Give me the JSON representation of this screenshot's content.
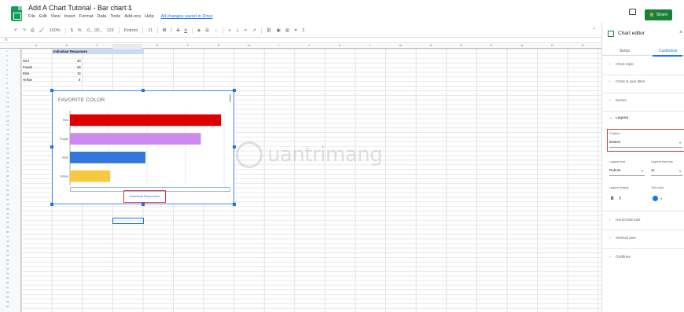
{
  "header": {
    "title": "Add A Chart Tutorial - Bar chart 1",
    "menu": [
      "File",
      "Edit",
      "View",
      "Insert",
      "Format",
      "Data",
      "Tools",
      "Add-ons",
      "Help"
    ],
    "saved_status": "All changes saved in Drive",
    "share_label": "Share"
  },
  "toolbar": {
    "zoom": "100%",
    "currency": "$",
    "percent": "%",
    "decimals": ".0_ .00_",
    "number_format": "123",
    "font": "Roboto",
    "font_size": "11",
    "bold": "B",
    "italic": "I",
    "strike": "S",
    "text_color": "A"
  },
  "sheet": {
    "columns": [
      "A",
      "B",
      "C",
      "D",
      "E",
      "F",
      "G",
      "H",
      "I",
      "J",
      "K",
      "L",
      "M",
      "N",
      "O",
      "P",
      "Q",
      "R",
      "S"
    ],
    "header_cell": "Individual Responses",
    "rows": [
      {
        "label": "Red",
        "value": "30"
      },
      {
        "label": "Purple",
        "value": "26"
      },
      {
        "label": "Blue",
        "value": "15"
      },
      {
        "label": "Yellow",
        "value": "8"
      }
    ]
  },
  "chart_data": {
    "type": "bar",
    "title": "FAVORITE COLOR",
    "categories": [
      "Red",
      "Purple",
      "Blue",
      "Yellow"
    ],
    "series": [
      {
        "name": "Individual Responses",
        "values": [
          30,
          26,
          15,
          8
        ]
      }
    ],
    "colors": [
      "#dd0000",
      "#cc88ee",
      "#3377dd",
      "#f7c940"
    ],
    "xlim": [
      0,
      30
    ],
    "grid": true,
    "legend_position": "bottom"
  },
  "editor": {
    "title": "Chart editor",
    "tabs": [
      "Setup",
      "Customize"
    ],
    "active_tab": "Customize",
    "sections": [
      "Chart style",
      "Chart & axis titles",
      "Series",
      "Legend",
      "Horizontal axis",
      "Vertical axis",
      "Gridlines"
    ],
    "legend": {
      "position_label": "Position",
      "position_value": "Bottom",
      "font_label": "Legend font",
      "font_value": "Roboto",
      "font_size_label": "Legend font size",
      "font_size_value": "11",
      "format_label": "Legend format",
      "bold": "B",
      "italic": "I",
      "text_color_label": "Text color"
    }
  },
  "watermark": {
    "text": "uantrimang"
  },
  "colors": {
    "accent": "#1a73e8",
    "share": "#188038",
    "highlight": "#e53935"
  }
}
